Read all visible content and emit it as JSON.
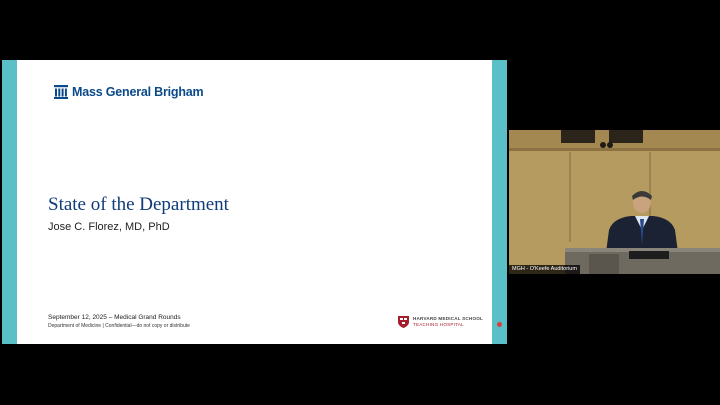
{
  "slide": {
    "logo_text": "Mass General Brigham",
    "title": "State of the Department",
    "subtitle": "Jose C. Florez, MD, PhD",
    "footer_date": "September 12, 2025 – Medical Grand Rounds",
    "footer_dept": "Department of Medicine   |   Confidential—do not copy or distribute",
    "hms_line1": "HARVARD MEDICAL SCHOOL",
    "hms_line2": "TEACHING HOSPITAL",
    "accent_color": "#5bbfc7",
    "title_color": "#0f3b7a"
  },
  "video": {
    "label": "MGH - O'Keefe Auditorium"
  }
}
